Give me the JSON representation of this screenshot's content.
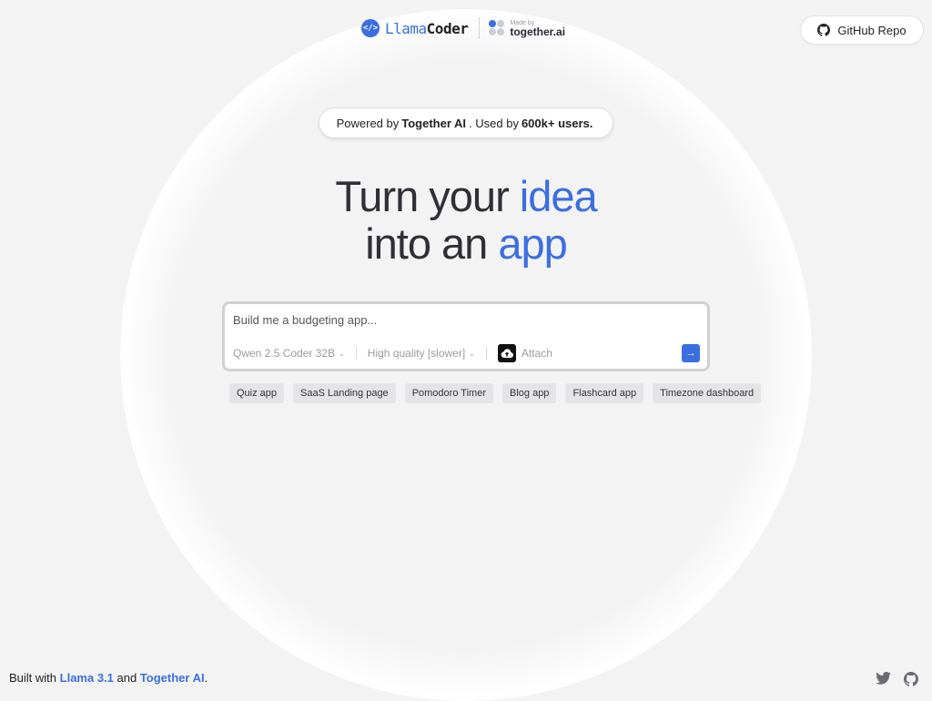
{
  "header": {
    "brand": {
      "logo_glyph": "</>",
      "name_part1": "Llama",
      "name_part2": "Coder"
    },
    "maker": {
      "top": "Made by",
      "name": "together.ai"
    },
    "github_label": "GitHub Repo"
  },
  "powered": {
    "prefix": "Powered by",
    "brand": "Together AI",
    "middle": ". Used by",
    "count": "600k+ users."
  },
  "headline": {
    "line1_a": "Turn your ",
    "line1_b": "idea",
    "line2_a": "into an ",
    "line2_b": "app"
  },
  "prompt": {
    "placeholder": "Build me a budgeting app...",
    "model": "Qwen 2.5 Coder 32B",
    "quality": "High quality [slower]",
    "attach_label": "Attach",
    "send_glyph": "→"
  },
  "suggestions": [
    "Quiz app",
    "SaaS Landing page",
    "Pomodoro Timer",
    "Blog app",
    "Flashcard app",
    "Timezone dashboard"
  ],
  "footer": {
    "prefix": "Built with ",
    "link1": "Llama 3.1",
    "middle": " and ",
    "link2": "Together AI",
    "suffix": "."
  },
  "icons": [
    "code-icon",
    "together-logo-icon",
    "github-icon",
    "chevron-down-icon",
    "upload-cloud-icon",
    "arrow-right-icon",
    "twitter-icon"
  ],
  "colors": {
    "accent": "#3b6fe0",
    "background": "#f3f3f4",
    "chip": "#e4e4e7"
  }
}
